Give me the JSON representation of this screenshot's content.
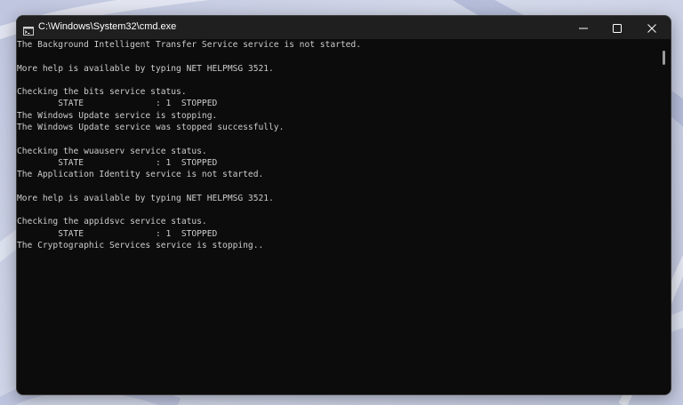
{
  "window": {
    "title": "C:\\Windows\\System32\\cmd.exe",
    "icon": "cmd-icon"
  },
  "controls": {
    "minimize_icon": "minimize-icon",
    "maximize_icon": "maximize-icon",
    "close_icon": "close-icon"
  },
  "console": {
    "lines": [
      "The Background Intelligent Transfer Service service is not started.",
      "",
      "More help is available by typing NET HELPMSG 3521.",
      "",
      "Checking the bits service status.",
      "        STATE              : 1  STOPPED",
      "The Windows Update service is stopping.",
      "The Windows Update service was stopped successfully.",
      "",
      "Checking the wuauserv service status.",
      "        STATE              : 1  STOPPED",
      "The Application Identity service is not started.",
      "",
      "More help is available by typing NET HELPMSG 3521.",
      "",
      "Checking the appidsvc service status.",
      "        STATE              : 1  STOPPED",
      "The Cryptographic Services service is stopping.."
    ]
  },
  "colors": {
    "console_background": "#0c0c0c",
    "console_text": "#cccccc",
    "titlebar": "#1f1f1f",
    "desktop": "#c9cfe2"
  }
}
